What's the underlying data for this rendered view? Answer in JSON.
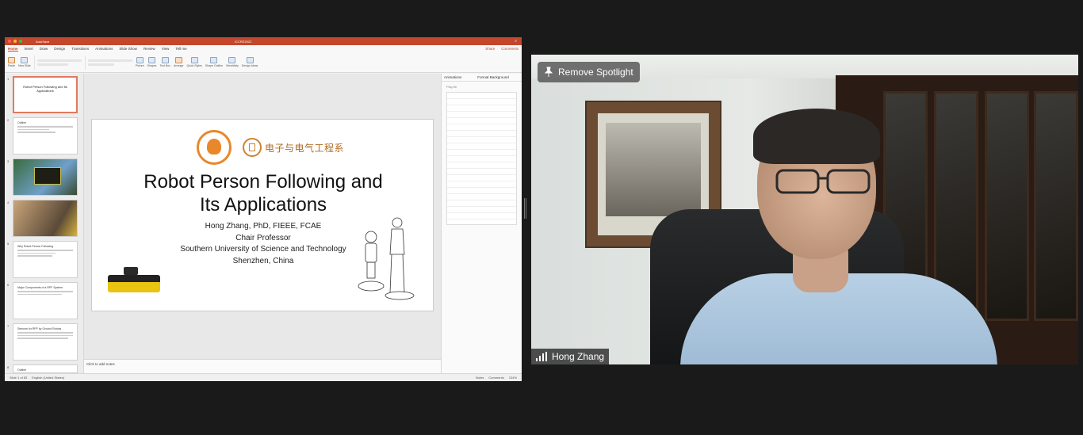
{
  "powerpoint": {
    "autosave": "AutoSave",
    "doc_title": "ICCRE2022",
    "menu": [
      "Home",
      "Insert",
      "Draw",
      "Design",
      "Transitions",
      "Animations",
      "Slide Show",
      "Review",
      "View",
      "Tell me"
    ],
    "share_label": "Share",
    "comments_label": "Comments",
    "ribbon_labels": [
      "Paste",
      "New Slide",
      "Picture",
      "Shapes",
      "Text Box",
      "Arrange",
      "Quick Styles",
      "Shape Outline",
      "Sensitivity",
      "Design Ideas"
    ],
    "thumbnails": [
      {
        "num": "1",
        "title": "Robot Person Following and Its Applications"
      },
      {
        "num": "2",
        "title": "Outline"
      },
      {
        "num": "3",
        "title": ""
      },
      {
        "num": "4",
        "title": ""
      },
      {
        "num": "5",
        "title": "Why Robot Person Following"
      },
      {
        "num": "6",
        "title": "Major Components of a RPF System"
      },
      {
        "num": "7",
        "title": "Sensors for RPF by Ground Robots"
      },
      {
        "num": "8",
        "title": "Outline"
      }
    ],
    "notes_placeholder": "Click to add notes",
    "animations_tab": "Animations",
    "format_background_tab": "Format Background",
    "play_all": "Play All",
    "status_left": "Slide 1 of 83",
    "status_lang": "English (United States)",
    "status_notes": "Notes",
    "status_comments": "Comments",
    "zoom": "134%"
  },
  "slide": {
    "dept_text": "电子与电气工程系",
    "title_line1": "Robot Person Following and",
    "title_line2": "Its Applications",
    "author": "Hong Zhang, PhD, FIEEE, FCAE",
    "position": "Chair Professor",
    "university": "Southern University of Science and Technology",
    "location": "Shenzhen, China"
  },
  "video": {
    "remove_spotlight": "Remove Spotlight",
    "participant_name": "Hong Zhang"
  },
  "colors": {
    "ppt_accent": "#c4462c",
    "slide_logo_orange": "#e8882a"
  }
}
